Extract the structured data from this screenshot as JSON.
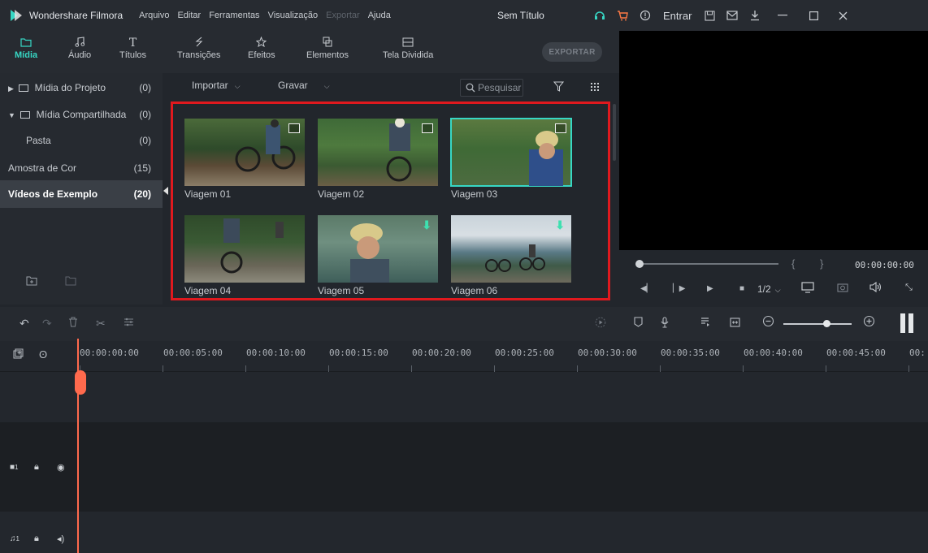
{
  "titlebar": {
    "app_name": "Wondershare Filmora",
    "menu": [
      "Arquivo",
      "Editar",
      "Ferramentas",
      "Visualização",
      "Exportar",
      "Ajuda"
    ],
    "document_title": "Sem Título",
    "login_label": "Entrar"
  },
  "modules": {
    "tabs": [
      {
        "label": "Mídia",
        "icon": "folder-icon",
        "active": true
      },
      {
        "label": "Áudio",
        "icon": "music-note-icon"
      },
      {
        "label": "Títulos",
        "icon": "text-icon"
      },
      {
        "label": "Transições",
        "icon": "transition-icon"
      },
      {
        "label": "Efeitos",
        "icon": "effects-icon"
      },
      {
        "label": "Elementos",
        "icon": "elements-icon"
      },
      {
        "label": "Tela Dividida",
        "icon": "split-screen-icon"
      }
    ],
    "export_label": "EXPORTAR"
  },
  "library": {
    "items": [
      {
        "name": "Mídia do Projeto",
        "count": "(0)"
      },
      {
        "name": "Mídia Compartilhada",
        "count": "(0)"
      },
      {
        "name": "Pasta",
        "count": "(0)"
      },
      {
        "name": "Amostra de Cor",
        "count": "(15)"
      },
      {
        "name": "Vídeos de Exemplo",
        "count": "(20)"
      }
    ]
  },
  "media": {
    "import_label": "Importar",
    "record_label": "Gravar",
    "search_placeholder": "Pesquisar",
    "clips": [
      "Viagem 01",
      "Viagem 02",
      "Viagem 03",
      "Viagem 04",
      "Viagem 05",
      "Viagem 06"
    ]
  },
  "preview": {
    "timecode": "00:00:00:00",
    "quality": "1/2"
  },
  "timeline": {
    "ticks": [
      "00:00:00:00",
      "00:00:05:00",
      "00:00:10:00",
      "00:00:15:00",
      "00:00:20:00",
      "00:00:25:00",
      "00:00:30:00",
      "00:00:35:00",
      "00:00:40:00",
      "00:00:45:00",
      "00:"
    ],
    "video_track_label": "1",
    "audio_track_label": "1"
  },
  "colors": {
    "accent": "#37d7c4",
    "highlight_border": "#e0191e",
    "playhead": "#ff6a4d"
  }
}
